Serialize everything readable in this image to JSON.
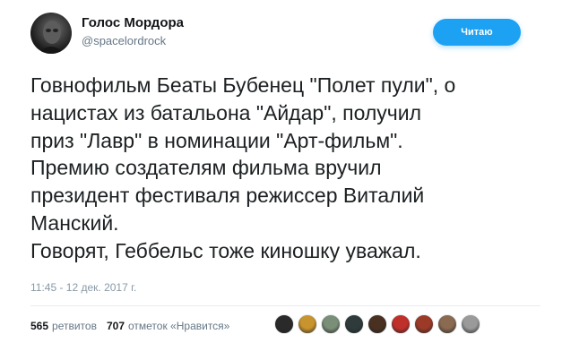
{
  "author": {
    "display_name": "Голос Мордора",
    "handle": "@spacelordrock"
  },
  "follow_button": {
    "label": "Читаю"
  },
  "tweet": {
    "lines": [
      "Говнофильм Беаты Бубенец \"Полет пули\", о",
      "нацистах из батальона \"Айдар\", получил",
      "приз \"Лавр\" в номинации \"Арт-фильм\".",
      "Премию создателям фильма вручил",
      "президент фестиваля режиссер Виталий",
      "Манский.",
      "Говорят, Геббельс тоже киношку уважал."
    ],
    "timestamp": "11:45 - 12 дек. 2017 г."
  },
  "stats": {
    "retweets_count": "565",
    "retweets_label": "ретвитов",
    "likes_count": "707",
    "likes_label": "отметок «Нравится»"
  },
  "likers": [
    {
      "avatar": "dark-figure-avatar",
      "color": "#2a2a2a"
    },
    {
      "avatar": "person-avatar",
      "color": "#c8942e"
    },
    {
      "avatar": "car-avatar",
      "color": "#7b8f78"
    },
    {
      "avatar": "dark-bird-avatar",
      "color": "#2e3b3a"
    },
    {
      "avatar": "face-avatar",
      "color": "#4a3020"
    },
    {
      "avatar": "red-emblem-avatar",
      "color": "#c0302a"
    },
    {
      "avatar": "person-red-avatar",
      "color": "#9c3a28"
    },
    {
      "avatar": "portrait-avatar",
      "color": "#8a6a50"
    },
    {
      "avatar": "grey-face-avatar",
      "color": "#9a9a9a"
    }
  ]
}
